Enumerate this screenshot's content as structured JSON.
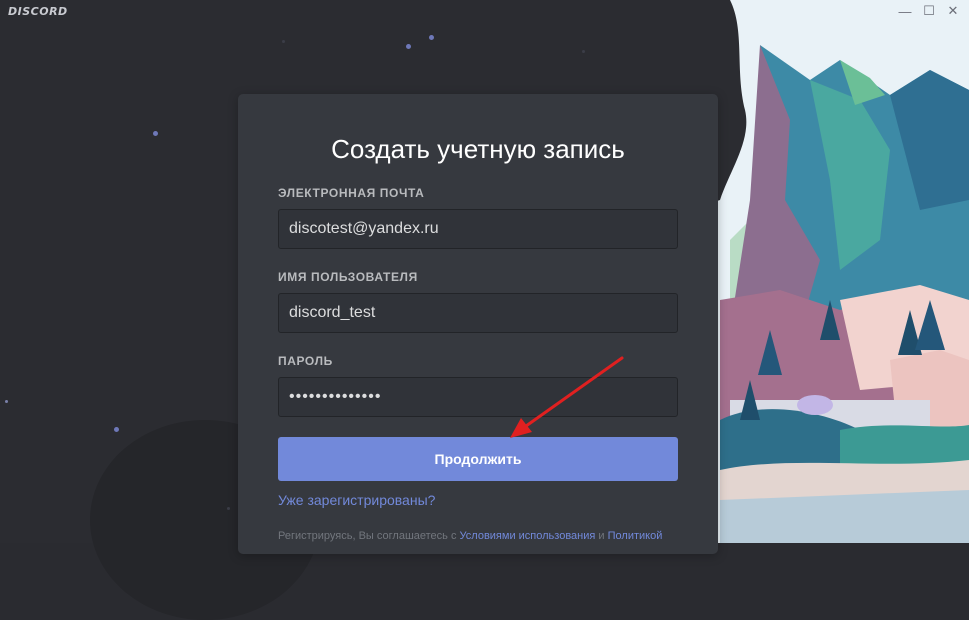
{
  "app": {
    "logo_text": "DISCORD"
  },
  "window_controls": {
    "minimize": "—",
    "maximize": "☐",
    "close": "✕"
  },
  "form": {
    "title": "Создать учетную запись",
    "email": {
      "label": "ЭЛЕКТРОННАЯ ПОЧТА",
      "value": "discotest@yandex.ru"
    },
    "username": {
      "label": "ИМЯ ПОЛЬЗОВАТЕЛЯ",
      "value": "discord_test"
    },
    "password": {
      "label": "ПАРОЛЬ",
      "value": "••••••••••••••"
    },
    "continue_label": "Продолжить",
    "already_registered": "Уже зарегистрированы?",
    "tos_prefix": "Регистрируясь, Вы соглашаетесь с",
    "tos_link": "Условиями использования",
    "tos_and": "и",
    "privacy_link": "Политикой"
  },
  "colors": {
    "accent": "#7289da",
    "card": "#36393f",
    "background": "#2b2c31",
    "annotation_arrow": "#e02020"
  }
}
